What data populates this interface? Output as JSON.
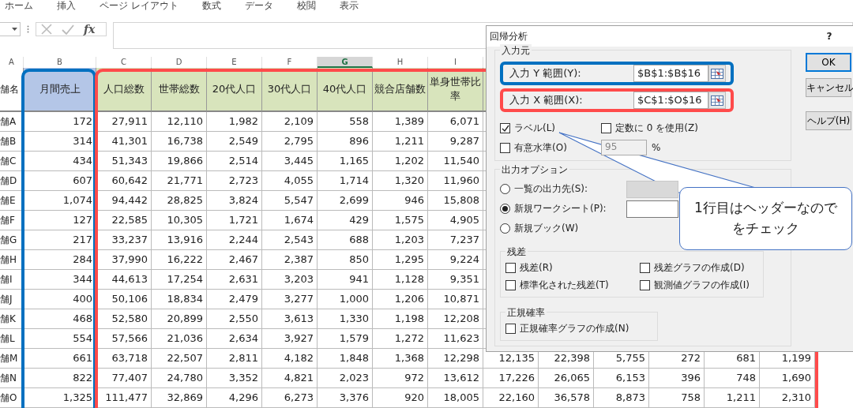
{
  "ribbon_tabs": [
    "ホーム",
    "挿入",
    "ページ レイアウト",
    "数式",
    "データ",
    "校閲",
    "表示"
  ],
  "formula_bar": {
    "function_label": "fx"
  },
  "column_letters": [
    {
      "label": "A",
      "selected": false
    },
    {
      "label": "B",
      "selected": false
    },
    {
      "label": "C",
      "selected": false
    },
    {
      "label": "D",
      "selected": false
    },
    {
      "label": "E",
      "selected": false
    },
    {
      "label": "F",
      "selected": false
    },
    {
      "label": "G",
      "selected": true
    },
    {
      "label": "H",
      "selected": false
    },
    {
      "label": "I",
      "selected": false
    }
  ],
  "table": {
    "header": [
      "舗名",
      "月間売上",
      "人口総数",
      "世帯総数",
      "20代人口",
      "30代人口",
      "40代人口",
      "競合店舗数",
      "単身世帯比率"
    ],
    "rows": [
      {
        "label": "舗A",
        "values": [
          "172",
          "27,911",
          "12,110",
          "1,982",
          "2,109",
          "558",
          "1,389",
          "6,071"
        ]
      },
      {
        "label": "舗B",
        "values": [
          "314",
          "41,301",
          "16,738",
          "2,549",
          "2,795",
          "896",
          "1,211",
          "9,287"
        ]
      },
      {
        "label": "舗C",
        "values": [
          "434",
          "51,343",
          "19,866",
          "2,514",
          "3,445",
          "1,165",
          "1,202",
          "11,540"
        ]
      },
      {
        "label": "舗D",
        "values": [
          "607",
          "60,642",
          "21,771",
          "2,723",
          "4,055",
          "1,714",
          "1,320",
          "11,960"
        ]
      },
      {
        "label": "舗E",
        "values": [
          "1,074",
          "94,442",
          "28,825",
          "3,824",
          "5,547",
          "2,699",
          "946",
          "15,808"
        ]
      },
      {
        "label": "舗F",
        "values": [
          "127",
          "22,585",
          "10,305",
          "1,721",
          "1,674",
          "429",
          "1,575",
          "4,905"
        ]
      },
      {
        "label": "舗G",
        "values": [
          "217",
          "33,237",
          "13,916",
          "2,244",
          "2,543",
          "688",
          "1,203",
          "7,237"
        ]
      },
      {
        "label": "舗H",
        "values": [
          "284",
          "37,990",
          "16,222",
          "2,467",
          "2,387",
          "850",
          "1,295",
          "9,224"
        ]
      },
      {
        "label": "舗I",
        "values": [
          "344",
          "44,613",
          "17,254",
          "2,631",
          "3,203",
          "941",
          "1,128",
          "9,351"
        ]
      },
      {
        "label": "舗J",
        "values": [
          "400",
          "50,106",
          "18,834",
          "2,479",
          "3,277",
          "1,000",
          "1,206",
          "10,871"
        ]
      },
      {
        "label": "舗K",
        "values": [
          "468",
          "52,580",
          "20,899",
          "2,550",
          "3,613",
          "1,330",
          "1,198",
          "12,208"
        ]
      },
      {
        "label": "舗L",
        "values": [
          "554",
          "57,566",
          "21,036",
          "2,634",
          "3,927",
          "1,579",
          "1,272",
          "11,623"
        ]
      },
      {
        "label": "舗M",
        "values": [
          "661",
          "63,718",
          "22,507",
          "2,811",
          "4,182",
          "1,848",
          "1,368",
          "12,298",
          "12,135",
          "22,398",
          "5,755",
          "272",
          "681",
          "1,199"
        ]
      },
      {
        "label": "舗N",
        "values": [
          "822",
          "77,407",
          "24,780",
          "3,352",
          "4,821",
          "2,023",
          "972",
          "13,612",
          "17,226",
          "26,065",
          "6,153",
          "396",
          "748",
          "1,690"
        ]
      },
      {
        "label": "舗O",
        "values": [
          "1,325",
          "111,477",
          "32,869",
          "4,296",
          "6,273",
          "3,376",
          "920",
          "18,005",
          "22,160",
          "36,578",
          "8,873",
          "758",
          "1,211",
          "2,310"
        ]
      }
    ]
  },
  "dialog": {
    "title": "回帰分析",
    "help_mark": "?",
    "input_group": {
      "label": "入力元",
      "y_range": {
        "label": "入力 Y 範囲(Y):",
        "value": "$B$1:$B$16"
      },
      "x_range": {
        "label": "入力 X 範囲(X):",
        "value": "$C$1:$O$16"
      },
      "options": [
        {
          "label": "ラベル(L)",
          "checked": true
        },
        {
          "label": "定数に 0 を使用(Z)",
          "checked": false
        },
        {
          "label": "有意水準(O)",
          "checked": false
        }
      ],
      "confidence": {
        "value": "95",
        "disabled": true,
        "unit": "%"
      }
    },
    "output_group": {
      "label": "出力オプション",
      "destinations": [
        {
          "label": "一覧の出力先(S):",
          "selected": false,
          "field": {
            "disabled": true
          }
        },
        {
          "label": "新規ワークシート(P):",
          "selected": true,
          "field": {
            "disabled": false
          }
        },
        {
          "label": "新規ブック(W)",
          "selected": false
        }
      ],
      "residuals": {
        "label": "残差",
        "options": [
          {
            "label": "残差(R)",
            "checked": false
          },
          {
            "label": "残差グラフの作成(D)",
            "checked": false
          },
          {
            "label": "標準化された残差(T)",
            "checked": false
          },
          {
            "label": "観測値グラフの作成(I)",
            "checked": false
          }
        ]
      },
      "normal_probability": {
        "label": "正規確率",
        "options": [
          {
            "label": "正規確率グラフの作成(N)",
            "checked": false
          }
        ]
      }
    },
    "buttons": [
      {
        "label": "OK",
        "default": true
      },
      {
        "label": "キャンセル",
        "default": false
      },
      {
        "label": "ヘルプ(H)",
        "default": false
      }
    ]
  },
  "callout": {
    "lines": [
      "1行目はヘッダーなので",
      "をチェック"
    ]
  }
}
